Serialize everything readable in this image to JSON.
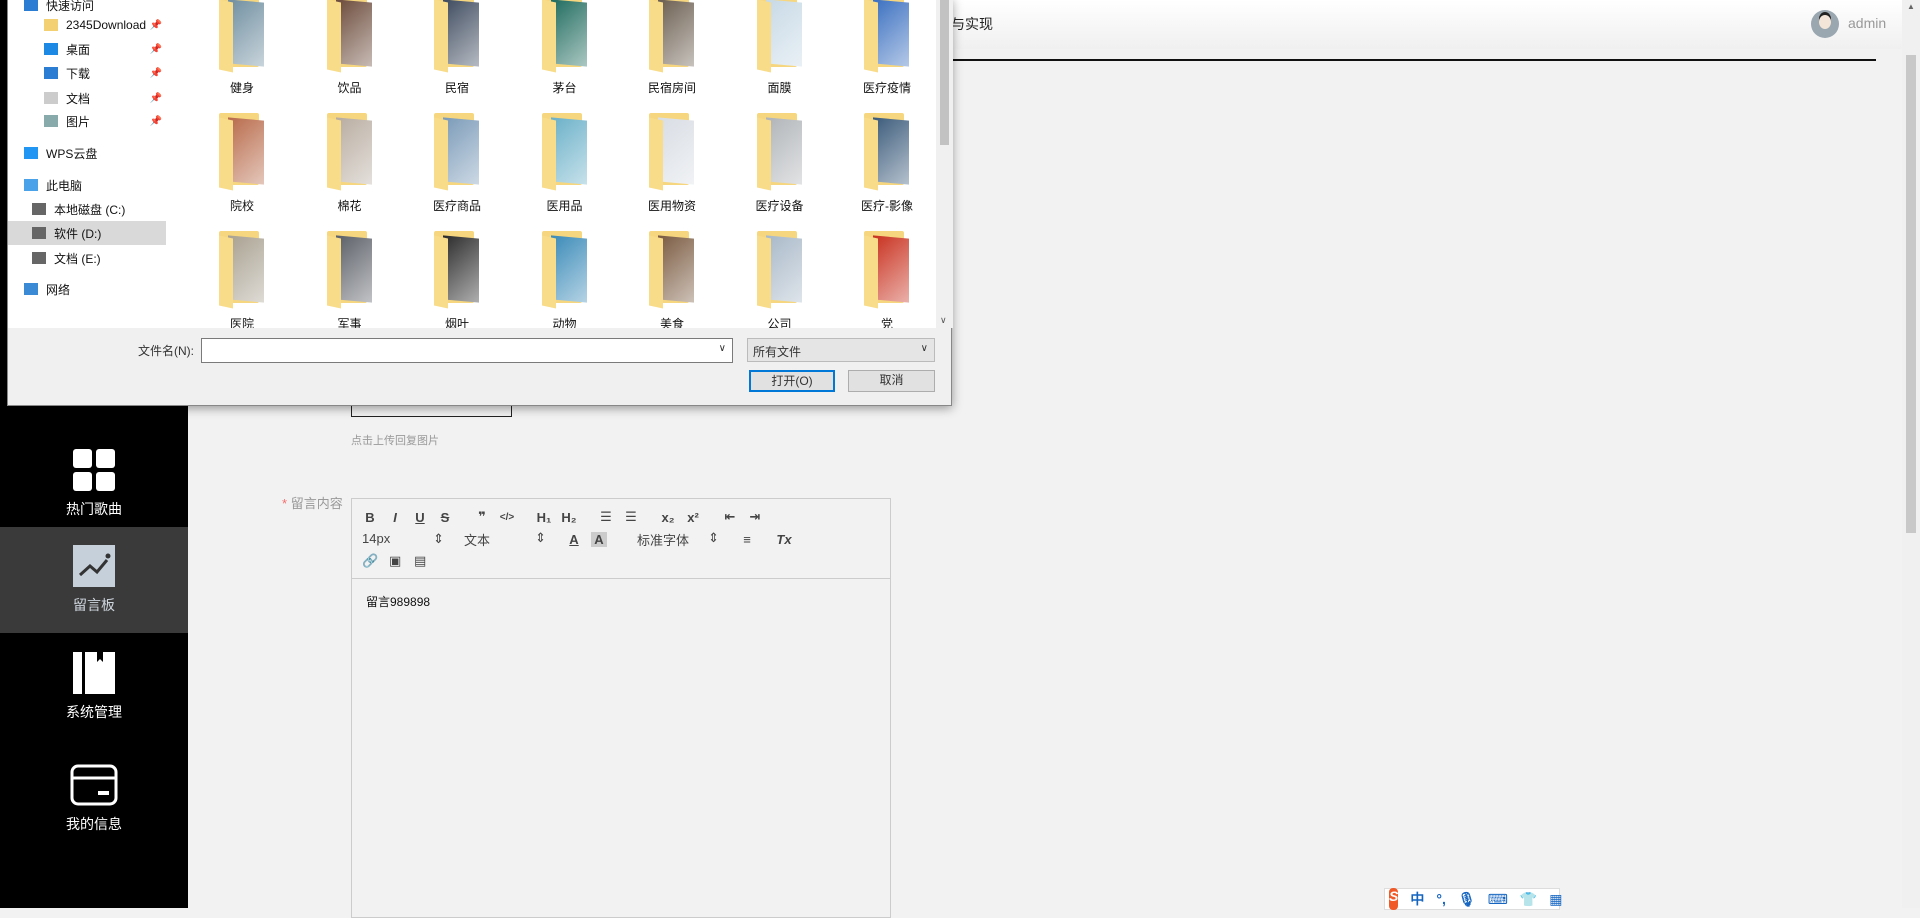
{
  "dialog": {
    "nav": [
      {
        "label": "快速访问",
        "icon": "star-icon"
      },
      {
        "label": "2345Download",
        "icon": "folder-icon",
        "pinned": true
      },
      {
        "label": "桌面",
        "icon": "desktop-icon",
        "pinned": true
      },
      {
        "label": "下载",
        "icon": "download-icon",
        "pinned": true
      },
      {
        "label": "文档",
        "icon": "document-icon",
        "pinned": true
      },
      {
        "label": "图片",
        "icon": "pictures-icon",
        "pinned": true
      },
      {
        "label": "WPS云盘",
        "icon": "cloud-icon"
      },
      {
        "label": "此电脑",
        "icon": "computer-icon"
      },
      {
        "label": "本地磁盘 (C:)",
        "icon": "drive-icon"
      },
      {
        "label": "软件 (D:)",
        "icon": "drive-icon",
        "selected": true
      },
      {
        "label": "文档 (E:)",
        "icon": "drive-icon"
      },
      {
        "label": "网络",
        "icon": "network-icon"
      }
    ],
    "folders": [
      {
        "name": "健身",
        "color": "#6f8ea0"
      },
      {
        "name": "饮品",
        "color": "#6b4a3a"
      },
      {
        "name": "民宿",
        "color": "#3d4a5e"
      },
      {
        "name": "茅台",
        "color": "#1f6b5e"
      },
      {
        "name": "民宿房间",
        "color": "#6b5e50"
      },
      {
        "name": "面膜",
        "color": "#c7d9e6"
      },
      {
        "name": "医疗疫情",
        "color": "#3a6fc0"
      },
      {
        "name": "院校",
        "color": "#b86a4a"
      },
      {
        "name": "棉花",
        "color": "#b8aca0"
      },
      {
        "name": "医疗商品",
        "color": "#7a9ab8"
      },
      {
        "name": "医用品",
        "color": "#6ab0c8"
      },
      {
        "name": "医用物资",
        "color": "#d8dde4"
      },
      {
        "name": "医疗设备",
        "color": "#b0b4b8"
      },
      {
        "name": "医疗-影像",
        "color": "#3a5a7a"
      },
      {
        "name": "医院",
        "color": "#a8a090"
      },
      {
        "name": "军事",
        "color": "#5a5e66"
      },
      {
        "name": "烟叶",
        "color": "#2a2a2a"
      },
      {
        "name": "动物",
        "color": "#3a8ab8"
      },
      {
        "name": "美食",
        "color": "#7a5a40"
      },
      {
        "name": "公司",
        "color": "#a8b8c8"
      },
      {
        "name": "党",
        "color": "#c8301e"
      }
    ],
    "filename_label": "文件名(N):",
    "filename_value": "",
    "filter": "所有文件",
    "open_label": "打开(O)",
    "cancel_label": "取消"
  },
  "header": {
    "title": "与实现",
    "user": "admin"
  },
  "sidebar": [
    {
      "label": "热门歌曲",
      "icon": "grid-icon"
    },
    {
      "label": "留言板",
      "icon": "chart-icon",
      "active": true
    },
    {
      "label": "系统管理",
      "icon": "book-icon"
    },
    {
      "label": "我的信息",
      "icon": "card-icon"
    }
  ],
  "form": {
    "upload_hint": "点击上传回复图片",
    "content_label": "留言内容",
    "required_mark": "*",
    "editor": {
      "size": "14px",
      "format": "文本",
      "font": "标准字体",
      "content": "留言989898"
    }
  },
  "ime": {
    "lang": "中",
    "punct": "°,"
  }
}
